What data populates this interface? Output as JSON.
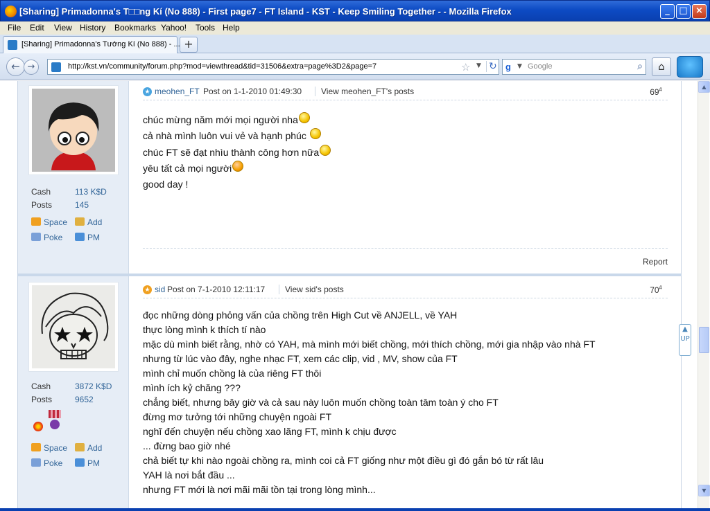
{
  "window": {
    "title": "[Sharing] Primadonna's T□□ng Kí (No 888) - First page7 - FT Island - KST - Keep Smiling Together - - Mozilla Firefox",
    "buttons": {
      "minimize": "_",
      "maximize": "□",
      "close": "×"
    }
  },
  "menu": [
    "File",
    "Edit",
    "View",
    "History",
    "Bookmarks",
    "Yahoo!",
    "Tools",
    "Help"
  ],
  "tabs": [
    {
      "label": "[Sharing] Primadonna's Tướng Kí (No 888) - ..."
    }
  ],
  "newtab_label": "+",
  "nav": {
    "back": "←",
    "forward": "→",
    "url": "http://kst.vn/community/forum.php?mod=viewthread&tid=31506&extra=page%3D2&page=7",
    "search_placeholder": "Google",
    "home": "⌂"
  },
  "posts": [
    {
      "author": "meohen_FT",
      "posted": "Post on 1-1-2010 01:49:30",
      "view_posts": "View meohen_FT's posts",
      "floor": "69",
      "floor_sup": "#",
      "stats": [
        {
          "k": "Cash",
          "v": "113 K$D"
        },
        {
          "k": "Posts",
          "v": "145"
        }
      ],
      "links": [
        "Space",
        "Add",
        "Poke",
        "PM"
      ],
      "lines": [
        "chúc mừng năm mới mọi người nha",
        "cả nhà mình luôn vui vẻ và hạnh phúc ",
        "chúc FT sẽ đạt nhìu thành công hơn nữa",
        "yêu tất cả mọi người",
        "good day !"
      ],
      "report": "Report"
    },
    {
      "author": "sid",
      "posted": "Post on 7-1-2010 12:11:17",
      "view_posts": "View sid's posts",
      "floor": "70",
      "floor_sup": "#",
      "stats": [
        {
          "k": "Cash",
          "v": "3872 K$D"
        },
        {
          "k": "Posts",
          "v": "9652"
        }
      ],
      "links": [
        "Space",
        "Add",
        "Poke",
        "PM"
      ],
      "lines": [
        "đọc những dòng phỏng vấn của chồng trên High Cut về ANJELL, về YAH",
        "thực lòng mình k thích tí nào",
        "mặc dù mình biết rằng, nhờ có YAH, mà mình mới biết chồng, mới thích chồng, mới gia nhập vào nhà FT",
        "nhưng từ lúc vào đây, nghe nhạc FT, xem các clip, vid , MV, show của FT",
        "mình chỉ muốn chồng là của riêng FT thôi",
        "mình ích kỷ chăng ???",
        "chẳng biết, nhưng bây giờ và cả sau này luôn muốn chồng toàn tâm toàn ý cho FT",
        "đừng mơ tưởng tới những chuyện ngoài FT",
        "nghĩ đến chuyện nếu chồng xao lãng FT, mình k chịu được",
        "... đừng bao giờ nhé",
        "chả biết tự khi nào ngoài chồng ra, mình coi cả FT giống như một điều gì đó gắn bó từ rất lâu",
        "YAH là nơi bắt đầu ...",
        "nhưng FT mới là nơi mãi mãi tồn tại trong lòng mình..."
      ]
    }
  ],
  "up_button": "UP"
}
